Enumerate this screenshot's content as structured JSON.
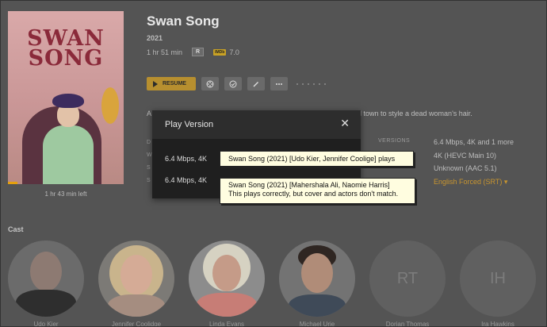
{
  "poster": {
    "title_line1": "SWAN",
    "title_line2": "SONG",
    "time_left": "1 hr 43 min left",
    "progress_fraction": 0.08
  },
  "movie": {
    "title": "Swan Song",
    "year": "2021",
    "duration": "1 hr 51 min",
    "rating": "R",
    "imdb_badge": "IMDb",
    "imdb_score": "7.0",
    "summary_lead": "A",
    "summary_tail": "l town to style a dead woman's hair."
  },
  "actions": {
    "resume_label": "RESUME",
    "icons": [
      "film-reel-icon",
      "check-circle-icon",
      "edit-pencil-icon",
      "more-dots-icon"
    ]
  },
  "details": {
    "left_letters": [
      "D",
      "W",
      "S",
      "S"
    ],
    "versions_label": "VERSIONS",
    "versions_values": [
      "6.4 Mbps, 4K and 1 more",
      "4K (HEVC Main 10)",
      "Unknown (AAC 5.1)",
      "English Forced (SRT)"
    ],
    "dropdown_glyph": "▾"
  },
  "cast": {
    "label": "Cast",
    "members": [
      {
        "name": "Udo Kier",
        "initials": ""
      },
      {
        "name": "Jennifer Coolidge",
        "initials": ""
      },
      {
        "name": "Linda Evans",
        "initials": ""
      },
      {
        "name": "Michael Urie",
        "initials": ""
      },
      {
        "name": "Dorian Thomas",
        "initials": "RT"
      },
      {
        "name": "Ira Hawkins",
        "initials": "IH"
      }
    ]
  },
  "modal": {
    "title": "Play Version",
    "close_glyph": "✕",
    "options": [
      "6.4 Mbps, 4K",
      "6.4 Mbps, 4K"
    ]
  },
  "callouts": {
    "first": "Swan Song (2021) [Udo Kier, Jennifer Coolige] plays",
    "second_line1": "Swan Song (2021) [Mahershala Ali, Naomie Harris]",
    "second_line2": "This plays correctly, but cover and actors don't match."
  },
  "colors": {
    "accent": "#e5a00d",
    "background": "#545454",
    "modal": "#1f1f1f",
    "callout": "#fffde0"
  }
}
